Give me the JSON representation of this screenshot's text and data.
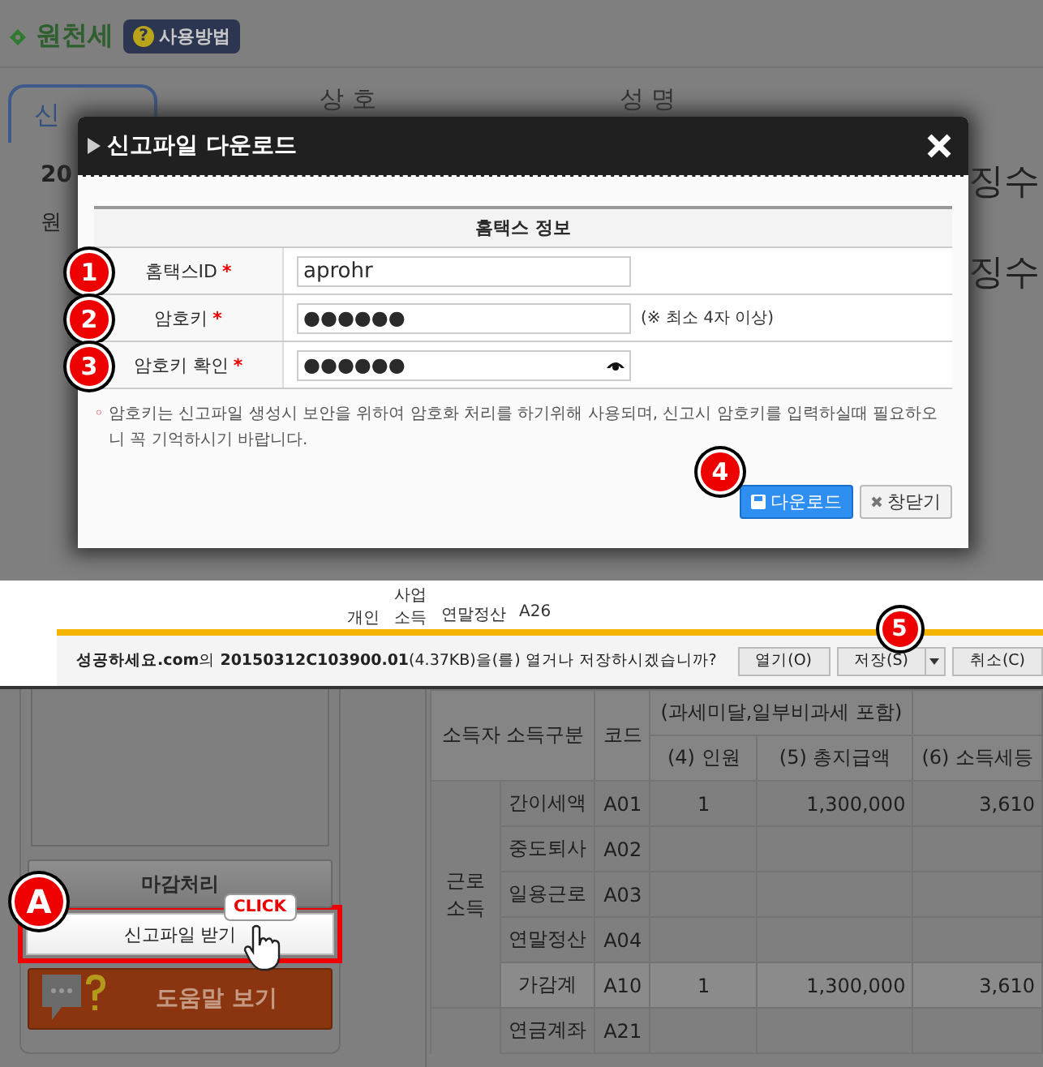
{
  "page": {
    "title": "원천세",
    "help_button": "사용방법",
    "help_icon": "?",
    "tab": "신",
    "column_headers": [
      "상 호",
      "성 명"
    ],
    "side_texts": [
      "20",
      "원"
    ],
    "right_texts": [
      "징수",
      "징수"
    ]
  },
  "dialog": {
    "title": "신고파일 다운로드",
    "section_title": "홈택스 정보",
    "fields": [
      {
        "badge": "1",
        "label": "홈택스ID",
        "mark": "*",
        "kind": "text",
        "value": "aprohr"
      },
      {
        "badge": "2",
        "label": "암호키",
        "mark": "*",
        "kind": "password",
        "value": "●●●●●●",
        "hint": "(※ 최소 4자 이상)"
      },
      {
        "badge": "3",
        "label": "암호키 확인",
        "mark": "*",
        "kind": "password_reveal",
        "value": "●●●●●●"
      }
    ],
    "bullet": "◦",
    "note": "암호키는 신고파일 생성시 보안을 위하여 암호화 처리를 하기위해 사용되며, 신고시 암호키를 입력하실때 필요하오니 꼭 기억하시기 바랍니다.",
    "buttons": [
      {
        "label": "다운로드",
        "kind": "primary",
        "badge": "4"
      },
      {
        "label": "창닫기",
        "kind": "secondary"
      }
    ]
  },
  "download_bar": {
    "table_fragment": [
      "개인",
      "사업 소득",
      "연말정산",
      "A26"
    ],
    "message": "**성공하세요.com**의 **20150312C103900.01**(4.37KB)을(를) 열거나 저장하시겠습니까?",
    "buttons": [
      {
        "label": "열기(O)",
        "menu": false
      },
      {
        "label": "저장(S)",
        "menu": true,
        "badge": "5"
      },
      {
        "label": "취소(C)",
        "menu": false
      }
    ]
  },
  "sidebar": {
    "close_button": "마감처리",
    "file_button": "신고파일 받기",
    "badge": "A",
    "callout": "CLICK",
    "help_button": "도움말 보기"
  },
  "table": {
    "header_group": "소득자 소득구분",
    "header_code": "코드",
    "header_note": "(과세미달,일부비과세 포함)",
    "columns": [
      "(4) 인원",
      "(5) 총지급액",
      "(6) 소득세등"
    ],
    "groups": [
      {
        "label": "근로 소득",
        "rows": [
          {
            "label": "간이세액",
            "code": "A01",
            "count": "1",
            "total": "1,300,000",
            "tax": "3,610",
            "kind": "normal"
          },
          {
            "label": "중도퇴사",
            "code": "A02",
            "kind": "normal"
          },
          {
            "label": "일용근로",
            "code": "A03",
            "kind": "normal"
          },
          {
            "label": "연말정산",
            "code": "A04",
            "kind": "normal"
          },
          {
            "label": "가감계",
            "code": "A10",
            "count": "1",
            "total": "1,300,000",
            "tax": "3,610",
            "kind": "subtotal"
          }
        ]
      }
    ],
    "extra_rows": [
      {
        "label": "연금계좌",
        "code": "A21"
      }
    ]
  }
}
